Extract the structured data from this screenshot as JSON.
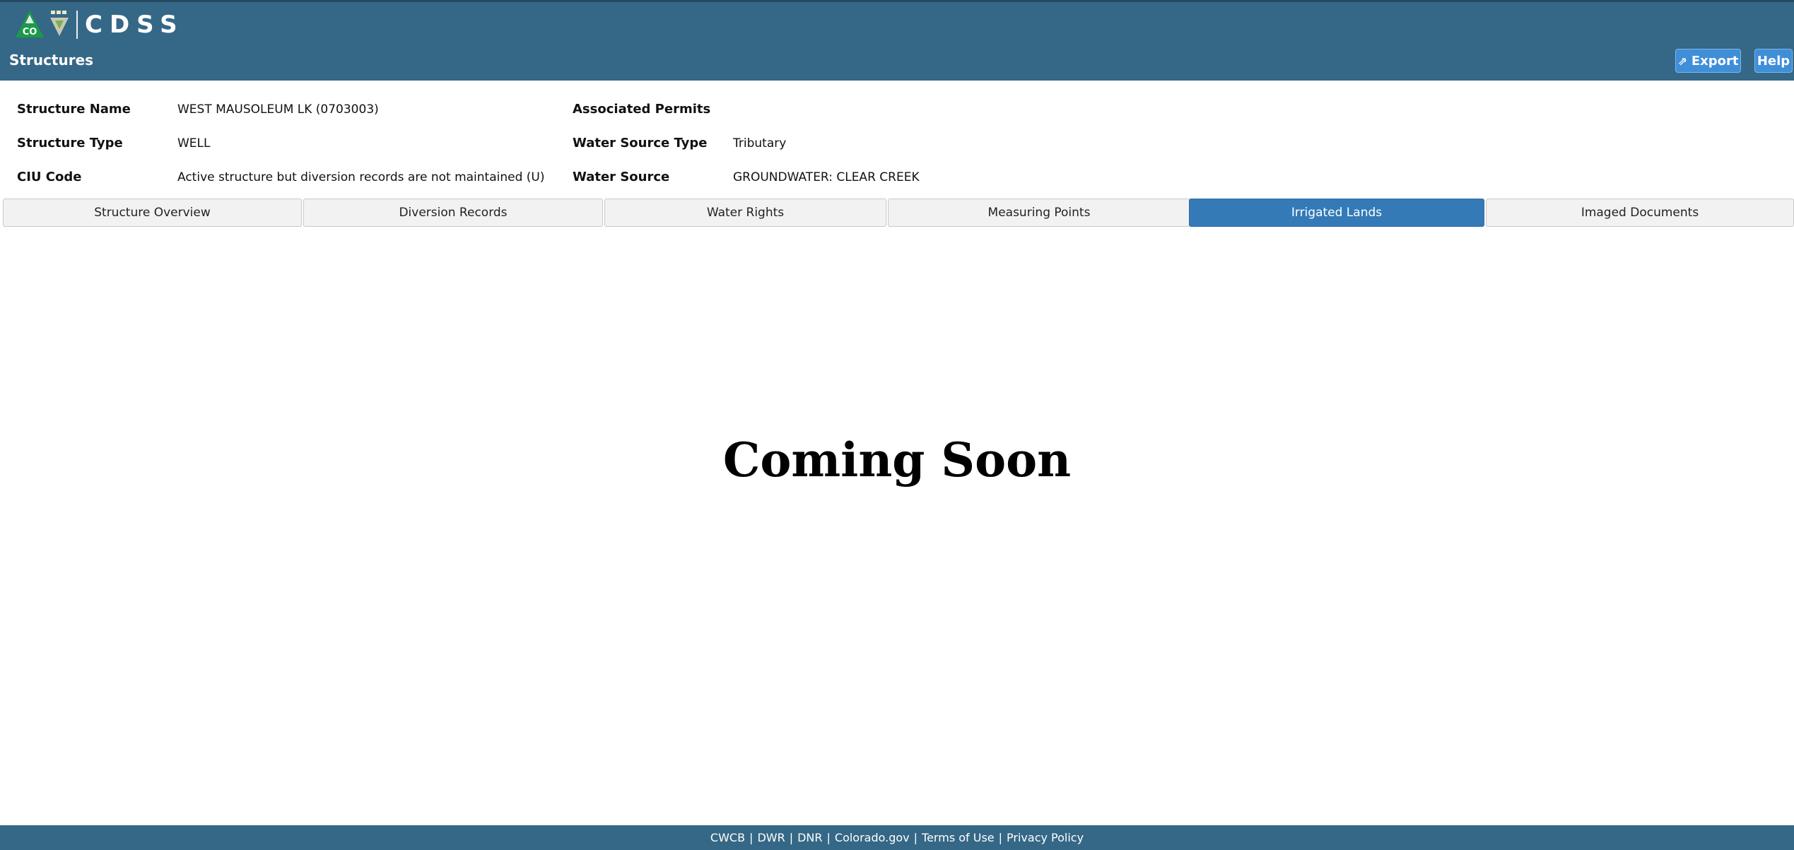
{
  "header": {
    "logo_badge_text": "CO",
    "logo_text": "CDSS",
    "page_title": "Structures",
    "export_label": "Export",
    "help_label": "Help",
    "background_color": "#356886",
    "button_color": "#3f8ed8"
  },
  "info": {
    "structure_name_label": "Structure Name",
    "structure_name_value": "WEST MAUSOLEUM LK (0703003)",
    "structure_type_label": "Structure Type",
    "structure_type_value": "WELL",
    "ciu_code_label": "CIU Code",
    "ciu_code_value": "Active structure but diversion records are not maintained (U)",
    "associated_permits_label": "Associated Permits",
    "associated_permits_value": "",
    "water_source_type_label": "Water Source Type",
    "water_source_type_value": "Tributary",
    "water_source_label": "Water Source",
    "water_source_value": "GROUNDWATER: CLEAR CREEK"
  },
  "tabs": [
    {
      "label": "Structure Overview",
      "active": false
    },
    {
      "label": "Diversion Records",
      "active": false
    },
    {
      "label": "Water Rights",
      "active": false
    },
    {
      "label": "Measuring Points",
      "active": false
    },
    {
      "label": "Irrigated Lands",
      "active": true
    },
    {
      "label": "Imaged Documents",
      "active": false
    }
  ],
  "active_tab_color": "#337ab7",
  "main": {
    "message": "Coming Soon"
  },
  "footer": {
    "links": [
      "CWCB",
      "DWR",
      "DNR",
      "Colorado.gov",
      "Terms of Use",
      "Privacy Policy"
    ],
    "separator": "|"
  }
}
